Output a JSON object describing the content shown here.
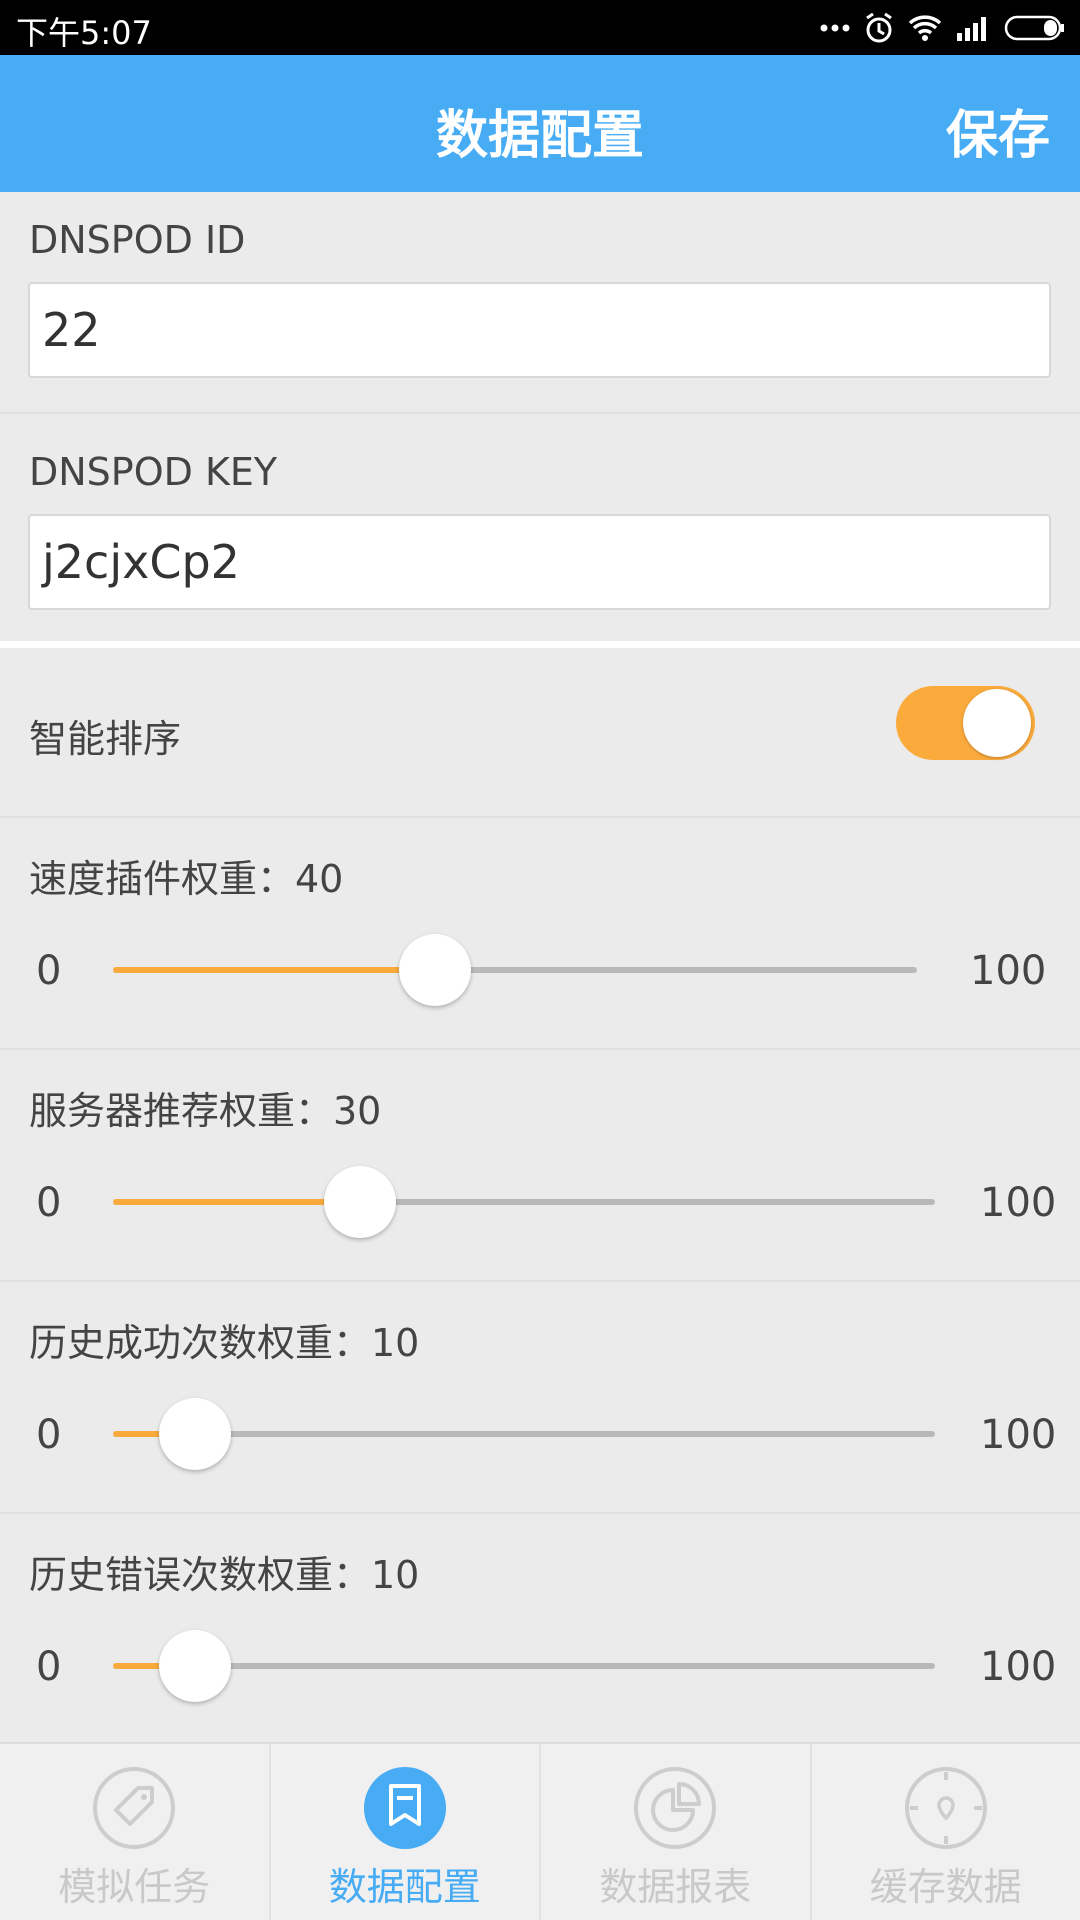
{
  "status_bar": {
    "time": "下午5:07",
    "icons": [
      "more-dots-icon",
      "alarm-icon",
      "wifi-icon",
      "signal-icon",
      "battery-icon"
    ]
  },
  "app_bar": {
    "title": "数据配置",
    "save_label": "保存",
    "color": "#47acf4"
  },
  "dnspod_id": {
    "label": "DNSPOD ID",
    "value": "22"
  },
  "dnspod_key": {
    "label": "DNSPOD KEY",
    "value": "j2cjxCp2"
  },
  "smart_sort": {
    "label": "智能排序",
    "on": true,
    "color": "#fbab3c"
  },
  "sliders": [
    {
      "label": "速度插件权重：40",
      "min": "0",
      "max": "100",
      "value": 40
    },
    {
      "label": "服务器推荐权重：30",
      "min": "0",
      "max": "100",
      "value": 30
    },
    {
      "label": "历史成功次数权重：10",
      "min": "0",
      "max": "100",
      "value": 10
    },
    {
      "label": "历史错误次数权重：10",
      "min": "0",
      "max": "100",
      "value": 10
    }
  ],
  "tabs": [
    {
      "label": "模拟任务",
      "icon": "tag-icon",
      "active": false
    },
    {
      "label": "数据配置",
      "icon": "bookmark-icon",
      "active": true
    },
    {
      "label": "数据报表",
      "icon": "pie-chart-icon",
      "active": false
    },
    {
      "label": "缓存数据",
      "icon": "compass-icon",
      "active": false
    }
  ]
}
